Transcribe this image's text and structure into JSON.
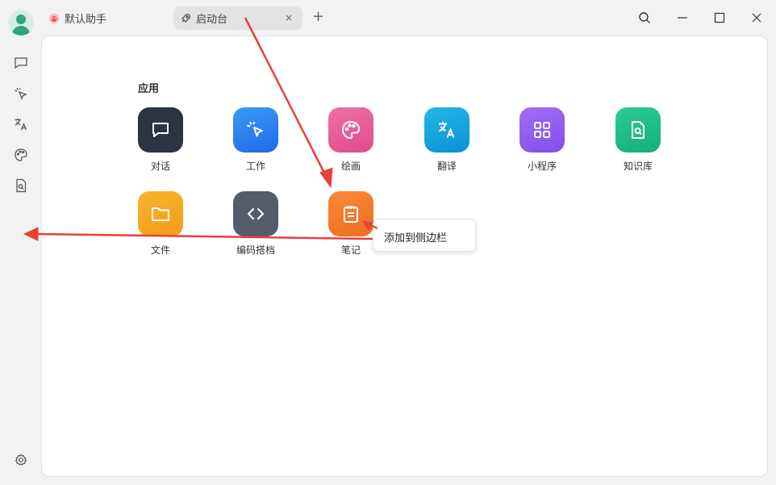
{
  "titlebar": {
    "tabs": [
      {
        "label": "默认助手",
        "icon": "assistant-emoji-icon"
      },
      {
        "label": "启动台",
        "icon": "rocket-icon",
        "close": "×"
      }
    ],
    "add_tab": "+",
    "window_buttons": [
      "search-icon",
      "minimize-icon",
      "maximize-icon",
      "close-icon"
    ]
  },
  "sidebar": {
    "items": [
      "chat-bubble-icon",
      "sparkle-cursor-icon",
      "translate-icon",
      "palette-icon",
      "document-search-icon"
    ],
    "bottom": "settings-gear-icon"
  },
  "main": {
    "section_title": "应用",
    "apps": [
      {
        "label": "对话",
        "icon": "chat-bubble-icon",
        "color": "#2c3441"
      },
      {
        "label": "工作",
        "icon": "sparkle-cursor-icon",
        "color": "#2f84f3"
      },
      {
        "label": "绘画",
        "icon": "palette-icon",
        "color": "#e95d9a"
      },
      {
        "label": "翻译",
        "icon": "translate-icon",
        "color": "#12a4df"
      },
      {
        "label": "小程序",
        "icon": "grid-icon",
        "color": "#8f5cf0"
      },
      {
        "label": "知识库",
        "icon": "document-search-icon",
        "color": "#1fbf8a"
      },
      {
        "label": "文件",
        "icon": "folder-icon",
        "color": "#f6a822"
      },
      {
        "label": "编码搭档",
        "icon": "code-icon",
        "color": "#545b6b"
      },
      {
        "label": "笔记",
        "icon": "notepad-icon",
        "color": "#f47d2b"
      }
    ]
  },
  "context_menu": {
    "item": "添加到侧边栏"
  },
  "annotation_color": "#e8403a"
}
